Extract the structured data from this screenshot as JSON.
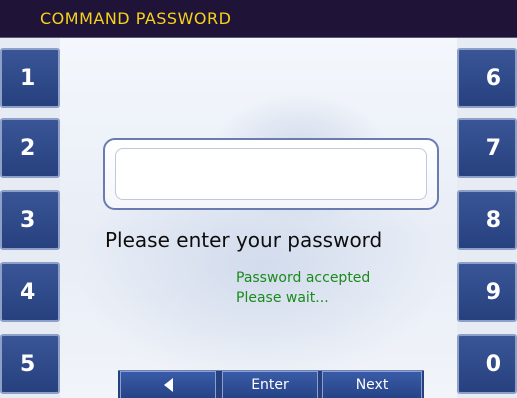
{
  "title": "COMMAND PASSWORD",
  "keypad": {
    "left": [
      "1",
      "2",
      "3",
      "4",
      "5"
    ],
    "right": [
      "6",
      "7",
      "8",
      "9",
      "0"
    ]
  },
  "password_field": {
    "value": ""
  },
  "prompt": "Please enter your password",
  "status": {
    "line1": "Password accepted",
    "line2": "Please wait..."
  },
  "nav": {
    "back_icon": "left-arrow-icon",
    "enter_label": "Enter",
    "next_label": "Next"
  },
  "colors": {
    "title_bg": "#1f1437",
    "title_text": "#f6d21a",
    "key_bg": "#27417f",
    "status_text": "#1b8a1b"
  }
}
